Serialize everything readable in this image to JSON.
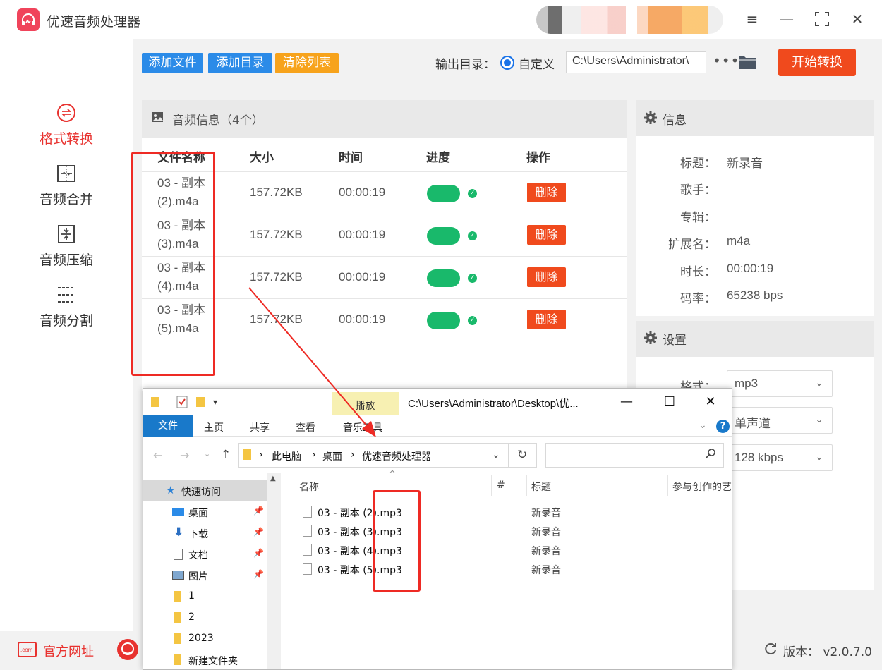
{
  "app": {
    "title": "优速音频处理器",
    "brand_color": "#f0445b",
    "accent_red": "#e8322f"
  },
  "sidebar": {
    "items": [
      {
        "label": "格式转换",
        "icon": "format-convert-icon",
        "active": true
      },
      {
        "label": "音频合并",
        "icon": "merge-icon",
        "active": false
      },
      {
        "label": "音频压缩",
        "icon": "compress-icon",
        "active": false
      },
      {
        "label": "音频分割",
        "icon": "split-icon",
        "active": false
      }
    ]
  },
  "toolbar": {
    "add_file": "添加文件",
    "add_dir": "添加目录",
    "clear_list": "清除列表",
    "output_label": "输出目录：",
    "custom_label": "自定义",
    "output_path": "C:\\Users\\Administrator\\",
    "start": "开始转换"
  },
  "audio_list": {
    "title": "音频信息（4个）",
    "columns": [
      "文件名称",
      "大小",
      "时间",
      "进度",
      "操作"
    ],
    "delete_label": "删除",
    "rows": [
      {
        "name_line1": "03 - 副本",
        "name_line2": "(2).m4a",
        "size": "157.72KB",
        "time": "00:00:19",
        "progress_done": true
      },
      {
        "name_line1": "03 - 副本",
        "name_line2": "(3).m4a",
        "size": "157.72KB",
        "time": "00:00:19",
        "progress_done": true
      },
      {
        "name_line1": "03 - 副本",
        "name_line2": "(4).m4a",
        "size": "157.72KB",
        "time": "00:00:19",
        "progress_done": true
      },
      {
        "name_line1": "03 - 副本",
        "name_line2": "(5).m4a",
        "size": "157.72KB",
        "time": "00:00:19",
        "progress_done": true
      }
    ]
  },
  "info": {
    "title": "信息",
    "fields": [
      {
        "label": "标题：",
        "value": "新录音"
      },
      {
        "label": "歌手：",
        "value": ""
      },
      {
        "label": "专辑：",
        "value": ""
      },
      {
        "label": "扩展名：",
        "value": "m4a"
      },
      {
        "label": "时长：",
        "value": "00:00:19"
      },
      {
        "label": "码率：",
        "value": "65238 bps"
      }
    ]
  },
  "settings": {
    "title": "设置",
    "format_label": "格式：",
    "format_value": "mp3",
    "channel_value": "单声道",
    "bitrate_value": "128 kbps"
  },
  "footer": {
    "website": "官方网址",
    "web_icon_text": ".com",
    "version": "版本：  v2.0.7.0"
  },
  "explorer": {
    "play_tab": "播放",
    "music_tools_tab": "音乐工具",
    "title": "C:\\Users\\Administrator\\Desktop\\优...",
    "tabs": [
      "文件",
      "主页",
      "共享",
      "查看"
    ],
    "breadcrumb": [
      "此电脑",
      "桌面",
      "优速音频处理器"
    ],
    "nav": [
      {
        "label": "快速访问",
        "icon": "star-icon"
      },
      {
        "label": "桌面",
        "icon": "desktop-icon"
      },
      {
        "label": "下载",
        "icon": "download-icon"
      },
      {
        "label": "文档",
        "icon": "document-icon"
      },
      {
        "label": "图片",
        "icon": "picture-icon"
      },
      {
        "label": "1",
        "icon": "folder-icon"
      },
      {
        "label": "2",
        "icon": "folder-icon"
      },
      {
        "label": "2023",
        "icon": "folder-icon"
      },
      {
        "label": "新建文件夹",
        "icon": "folder-icon"
      }
    ],
    "columns": [
      "名称",
      "#",
      "标题",
      "参与创作的艺"
    ],
    "files": [
      {
        "name": "03 - 副本 (2).mp3",
        "title": "新录音"
      },
      {
        "name": "03 - 副本 (3).mp3",
        "title": "新录音"
      },
      {
        "name": "03 - 副本 (4).mp3",
        "title": "新录音"
      },
      {
        "name": "03 - 副本 (5).mp3",
        "title": "新录音"
      }
    ]
  }
}
